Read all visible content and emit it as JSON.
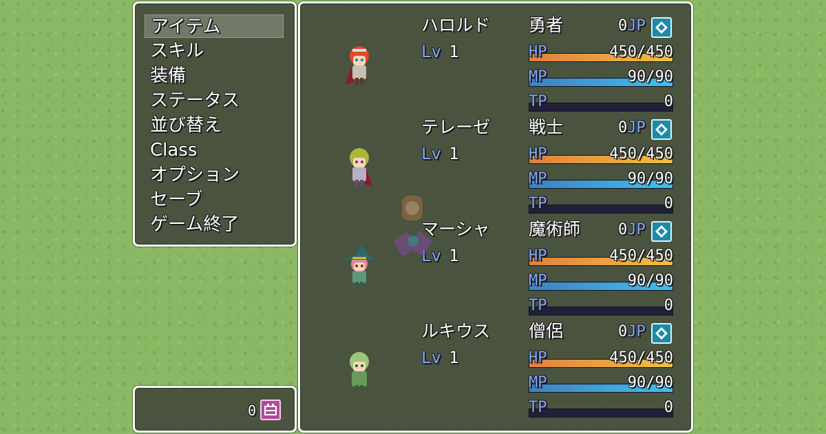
{
  "menu": {
    "items": [
      {
        "label": "アイテム",
        "selected": true
      },
      {
        "label": "スキル"
      },
      {
        "label": "装備"
      },
      {
        "label": "ステータス"
      },
      {
        "label": "並び替え"
      },
      {
        "label": "Class"
      },
      {
        "label": "オプション"
      },
      {
        "label": "セーブ"
      },
      {
        "label": "ゲーム終了"
      }
    ]
  },
  "gold": {
    "value": "0",
    "icon": "gold-icon"
  },
  "party": [
    {
      "name": "ハロルド",
      "class": "勇者",
      "lv_label": "Lv",
      "lv": "1",
      "jp": "0",
      "jp_unit": "JP",
      "hp_label": "HP",
      "hp": "450/450",
      "hp_rate": 1.0,
      "mp_label": "MP",
      "mp": "90/90",
      "mp_rate": 1.0,
      "tp_label": "TP",
      "tp": "0",
      "tp_rate": 0.0,
      "sprite": "hero-red-hair"
    },
    {
      "name": "テレーゼ",
      "class": "戦士",
      "lv_label": "Lv",
      "lv": "1",
      "jp": "0",
      "jp_unit": "JP",
      "hp_label": "HP",
      "hp": "450/450",
      "hp_rate": 1.0,
      "mp_label": "MP",
      "mp": "90/90",
      "mp_rate": 1.0,
      "tp_label": "TP",
      "tp": "0",
      "tp_rate": 0.0,
      "sprite": "warrior-green-hair"
    },
    {
      "name": "マーシャ",
      "class": "魔術師",
      "lv_label": "Lv",
      "lv": "1",
      "jp": "0",
      "jp_unit": "JP",
      "hp_label": "HP",
      "hp": "450/450",
      "hp_rate": 1.0,
      "mp_label": "MP",
      "mp": "90/90",
      "mp_rate": 1.0,
      "tp_label": "TP",
      "tp": "0",
      "tp_rate": 0.0,
      "sprite": "mage-witch-hat"
    },
    {
      "name": "ルキウス",
      "class": "僧侶",
      "lv_label": "Lv",
      "lv": "1",
      "jp": "0",
      "jp_unit": "JP",
      "hp_label": "HP",
      "hp": "450/450",
      "hp_rate": 1.0,
      "mp_label": "MP",
      "mp": "90/90",
      "mp_rate": 1.0,
      "tp_label": "TP",
      "tp": "0",
      "tp_rate": 0.0,
      "sprite": "priest-green-hair"
    }
  ],
  "colors": {
    "window_bg": "#444a3a",
    "window_border": "#ffffff",
    "system_blue": "#84aaff",
    "hp_gauge": "#e08040",
    "mp_gauge": "#40a0e0",
    "gauge_back": "#20203a",
    "grass": "#8bb864"
  }
}
